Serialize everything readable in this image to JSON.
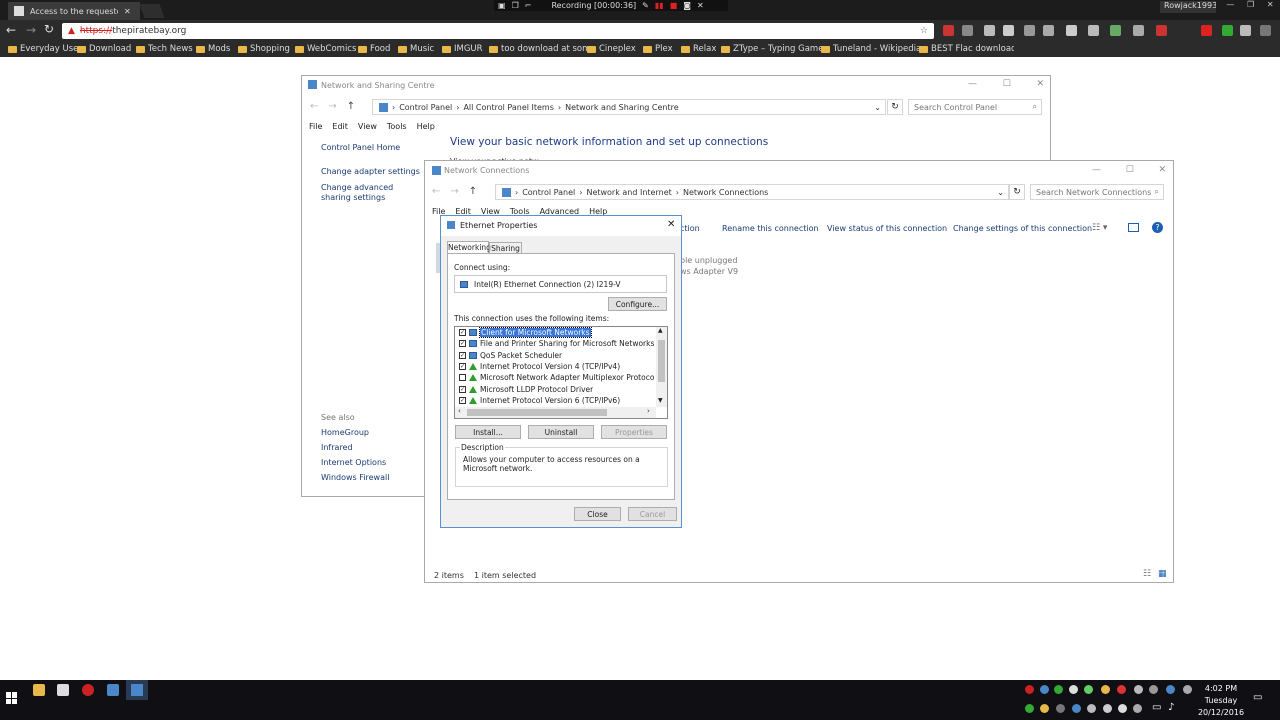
{
  "browser": {
    "tab_title": "Access to the requested",
    "url_scheme": "https://",
    "url_host": "thepiratebay.org",
    "user": "Rowjack1993",
    "recording": "Recording [00:00:36]",
    "bookmarks": [
      "Everyday Use",
      "Download",
      "Tech News",
      "Mods",
      "Shopping",
      "WebComics",
      "Food",
      "Music",
      "IMGUR",
      "too download at some",
      "Cineplex",
      "Plex",
      "Relax",
      "ZType – Typing Game",
      "Tuneland - Wikipedia",
      "BEST Flac download I"
    ],
    "ext_colors": [
      "#c33",
      "#888",
      "#bbb",
      "#ccc",
      "#999",
      "#aaa",
      "#ccc",
      "#bbb",
      "#6a6",
      "#aaa",
      "#c33",
      "#d22",
      "#3a3",
      "#bbb",
      "#777",
      "#999"
    ]
  },
  "nsc": {
    "title": "Network and Sharing Centre",
    "crumbs": [
      "Control Panel",
      "All Control Panel Items",
      "Network and Sharing Centre"
    ],
    "search_placeholder": "Search Control Panel",
    "menu": [
      "File",
      "Edit",
      "View",
      "Tools",
      "Help"
    ],
    "home": "Control Panel Home",
    "side_links": [
      "Change adapter settings",
      "Change advanced sharing settings"
    ],
    "heading": "View your basic network information and set up connections",
    "heading2": "View your active networks",
    "see_also": "See also",
    "see_also_links": [
      "HomeGroup",
      "Infrared",
      "Internet Options",
      "Windows Firewall"
    ]
  },
  "nc": {
    "title": "Network Connections",
    "crumbs": [
      "Control Panel",
      "Network and Internet",
      "Network Connections"
    ],
    "search_placeholder": "Search Network Connections",
    "menu": [
      "File",
      "Edit",
      "View",
      "Tools",
      "Advanced",
      "Help"
    ],
    "commands": [
      "ction",
      "Rename this connection",
      "View status of this connection",
      "Change settings of this connection"
    ],
    "item_line1": "ble unplugged",
    "item_line2": "ws Adapter V9",
    "status_count": "2 items",
    "status_selected": "1 item selected"
  },
  "dialog": {
    "title": "Ethernet Properties",
    "tabs": [
      "Networking",
      "Sharing"
    ],
    "connect_using": "Connect using:",
    "adapter": "Intel(R) Ethernet Connection (2) I219-V",
    "configure": "Configure...",
    "list_label": "This connection uses the following items:",
    "items": [
      {
        "label": "Client for Microsoft Networks",
        "checked": true,
        "icon": "network-icon",
        "selected": true
      },
      {
        "label": "File and Printer Sharing for Microsoft Networks",
        "checked": true,
        "icon": "network-icon",
        "selected": false
      },
      {
        "label": "QoS Packet Scheduler",
        "checked": true,
        "icon": "network-icon",
        "selected": false
      },
      {
        "label": "Internet Protocol Version 4 (TCP/IPv4)",
        "checked": true,
        "icon": "protocol-icon",
        "selected": false
      },
      {
        "label": "Microsoft Network Adapter Multiplexor Protocol",
        "checked": false,
        "icon": "protocol-icon",
        "selected": false
      },
      {
        "label": "Microsoft LLDP Protocol Driver",
        "checked": true,
        "icon": "protocol-icon",
        "selected": false
      },
      {
        "label": "Internet Protocol Version 6 (TCP/IPv6)",
        "checked": true,
        "icon": "protocol-icon",
        "selected": false
      }
    ],
    "install": "Install...",
    "uninstall": "Uninstall",
    "properties": "Properties",
    "description_label": "Description",
    "description": "Allows your computer to access resources on a Microsoft network.",
    "close": "Close",
    "cancel": "Cancel"
  },
  "taskbar": {
    "time": "4:02 PM",
    "day": "Tuesday",
    "date": "20/12/2016",
    "app_colors": [
      "#e8b84a",
      "#ddd",
      "#c22",
      "#4a86c8"
    ],
    "tray_colors": [
      "#c22",
      "#4a86c8",
      "#3a3",
      "#ddd",
      "#6c6",
      "#e8b84a",
      "#d33",
      "#bbb",
      "#999",
      "#4a86c8",
      "#aaa",
      "#3a3",
      "#e8b84a",
      "#777",
      "#4a86c8",
      "#bbb",
      "#ccc",
      "#ddd",
      "#aaa"
    ]
  }
}
